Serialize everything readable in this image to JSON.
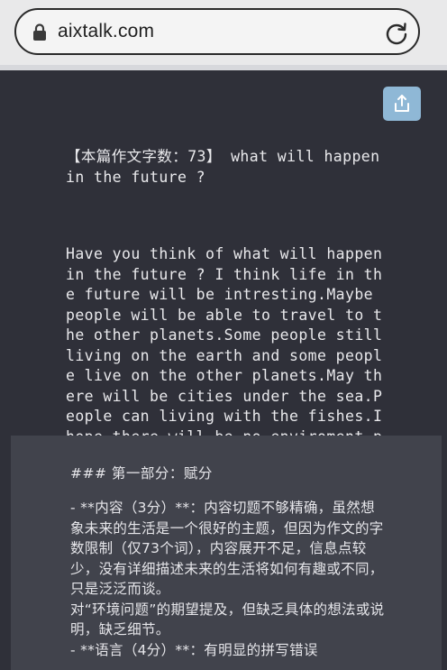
{
  "browser": {
    "url": "aixtalk.com"
  },
  "essay": {
    "title_line": "【本篇作文字数：73】 what will happen in the future ?",
    "body": "Have you think of what will happen in the future ? I think life in the future will be intresting.Maybe people will be able to travel to the other planets.Some people still living on the earth and some people live on the other planets.May there will be cities under the sea.People can living with the fishes.I hope there will be no enviroment proplems in the future."
  },
  "feedback": {
    "heading": "### 第一部分：赋分",
    "content_item": "- **内容（3分）**：内容切题不够精确，虽然想象未来的生活是一个很好的主题，但因为作文的字数限制（仅73个词），内容展开不足，信息点较少，没有详细描述未来的生活将如何有趣或不同，只是泛泛而谈。",
    "content_item_2": "对“环境问题”的期望提及，但缺乏具体的想法或说明，缺乏细节。",
    "language_item": "- **语言（4分）**：有明显的拼写错误"
  },
  "icons": {
    "lock": "lock-icon",
    "reload": "reload-icon",
    "share": "share-icon"
  },
  "colors": {
    "background": "#2f3039",
    "feedback_panel": "#41434c",
    "share_button": "#8fb8d6"
  }
}
